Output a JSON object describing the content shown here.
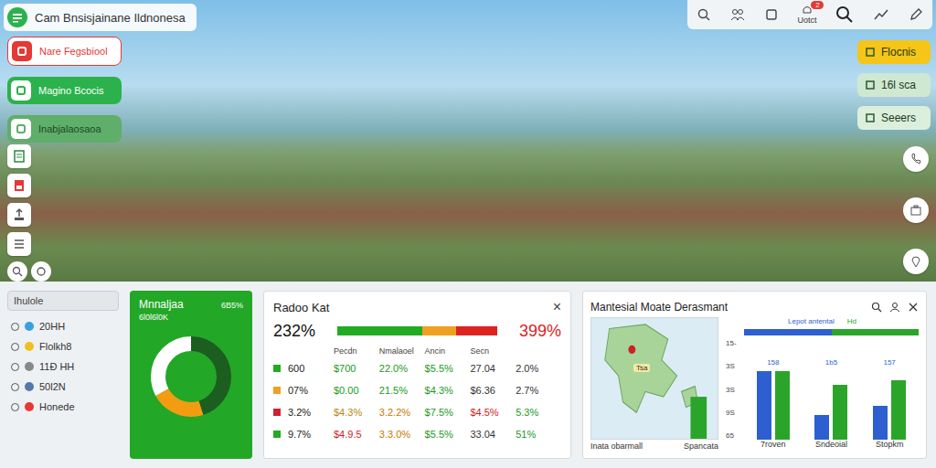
{
  "app": {
    "title": "Cam Bnsisjainane Ildnonesa"
  },
  "left_actions": [
    {
      "label": "Nare Fegsbiool",
      "color": "#e53935"
    },
    {
      "label": "Magino Bcocis",
      "color": "#2bb24c"
    },
    {
      "label": "Inabjalaosaoa",
      "color": "#5fae6a"
    }
  ],
  "toolbar": {
    "label": "Uotct",
    "badge": "2"
  },
  "right_actions": [
    {
      "label": "Flocnis",
      "color": "#f5c518"
    },
    {
      "label": "16l sca",
      "color": "#cfe8d2"
    },
    {
      "label": "Seeers",
      "color": "#dcefdd"
    }
  ],
  "sidebar": {
    "search": "Ihulole",
    "items": [
      {
        "label": "20HH",
        "color": "#3aa0e0"
      },
      {
        "label": "Flolkh8",
        "color": "#f0c020"
      },
      {
        "label": "11Ð HH",
        "color": "#888888"
      },
      {
        "label": "50l2N",
        "color": "#5577aa"
      },
      {
        "label": "Honede",
        "color": "#e53935"
      }
    ]
  },
  "donut_card": {
    "title": "Mnnaljaa",
    "value": "6B5%",
    "subtitle": "6l0l6l0K",
    "segments": [
      {
        "value": 45,
        "color": "#1b5e20"
      },
      {
        "value": 22,
        "color": "#f39c12"
      },
      {
        "value": 33,
        "color": "#ffffff"
      }
    ]
  },
  "table_card": {
    "title": "Radoo Kat",
    "close": "×",
    "left_value": "232%",
    "right_value": "399%",
    "bar": [
      {
        "value": 53,
        "color": "#22aa22"
      },
      {
        "value": 21,
        "color": "#f0a020"
      },
      {
        "value": 26,
        "color": "#dd2222"
      }
    ],
    "columns": [
      "Pecdn",
      "Nmalaoel",
      "Ancin",
      "Secn"
    ],
    "rows": [
      {
        "marker": "#22aa22",
        "cells": [
          {
            "text": "600",
            "color": "#222222"
          },
          {
            "text": "$700",
            "color": "#1a9a1a"
          },
          {
            "text": "22.0%",
            "color": "#1a9a1a"
          },
          {
            "text": "$5.5%",
            "color": "#1a9a1a"
          },
          {
            "text": "27.04",
            "color": "#333333"
          },
          {
            "text": "2.0%",
            "color": "#333333"
          }
        ]
      },
      {
        "marker": "#f0a020",
        "cells": [
          {
            "text": "07%",
            "color": "#222222"
          },
          {
            "text": "$0.00",
            "color": "#1a9a1a"
          },
          {
            "text": "21.5%",
            "color": "#1a9a1a"
          },
          {
            "text": "$4.3%",
            "color": "#1a9a1a"
          },
          {
            "text": "$6.36",
            "color": "#333333"
          },
          {
            "text": "2.7%",
            "color": "#333333"
          }
        ]
      },
      {
        "marker": "#cc2233",
        "cells": [
          {
            "text": "3.2%",
            "color": "#222222"
          },
          {
            "text": "$4.3%",
            "color": "#b8860b"
          },
          {
            "text": "3.2.2%",
            "color": "#c77800"
          },
          {
            "text": "$7.5%",
            "color": "#1a9a1a"
          },
          {
            "text": "$4.5%",
            "color": "#cc2222"
          },
          {
            "text": "5.3%",
            "color": "#1a9a1a"
          }
        ]
      },
      {
        "marker": "#22aa22",
        "cells": [
          {
            "text": "9.7%",
            "color": "#222222"
          },
          {
            "text": "$4.9.5",
            "color": "#cc2222"
          },
          {
            "text": "3.3.0%",
            "color": "#c77800"
          },
          {
            "text": "$5.5%",
            "color": "#1a9a1a"
          },
          {
            "text": "33.04",
            "color": "#333333"
          },
          {
            "text": "51%",
            "color": "#1a9a1a"
          }
        ]
      }
    ]
  },
  "map_card": {
    "title": "Mantesial Moate Derasmant",
    "pin": "Tsa",
    "map_labels": [
      "Inata obarmall",
      "Spancata"
    ],
    "chart": {
      "ticks": [
        "15-",
        "3S",
        "3S",
        "9S",
        "65"
      ],
      "max": 160,
      "series": [
        {
          "name": "Lepot antental",
          "color": "#2d5fd0",
          "values": [
            150,
            55,
            75
          ]
        },
        {
          "name": "Hd",
          "color": "#2aa52a",
          "values": [
            150,
            120,
            130
          ]
        }
      ],
      "groups": [
        {
          "name": "7roven",
          "label": "158"
        },
        {
          "name": "Sndeoial",
          "label": "1b5"
        },
        {
          "name": "Stopkm",
          "label": "157"
        }
      ]
    }
  }
}
